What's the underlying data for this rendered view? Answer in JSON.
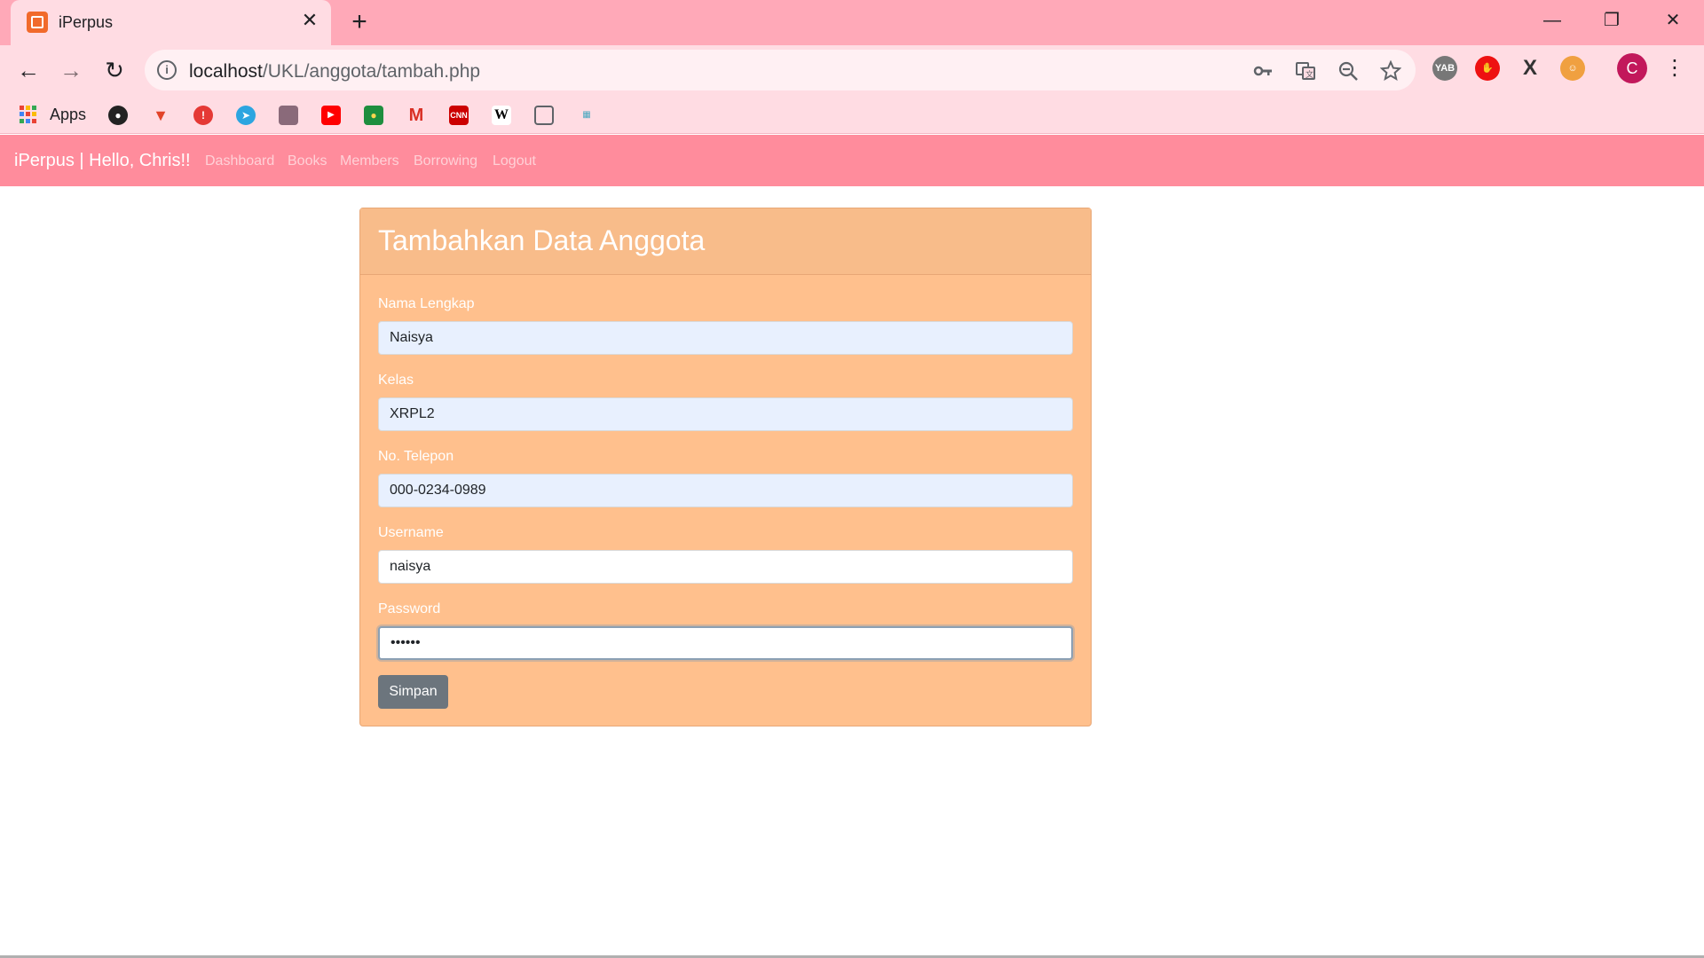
{
  "browser": {
    "tab_title": "iPerpus",
    "tab_close": "✕",
    "new_tab": "+",
    "url_host": "localhost",
    "url_path": "/UKL/anggota/tambah.php",
    "profile_initial": "C",
    "window_controls": {
      "minimize": "—",
      "restore": "❐",
      "close": "✕"
    },
    "nav": {
      "back": "←",
      "forward": "→",
      "reload": "↻"
    },
    "omnibox_icons": [
      "key-icon",
      "translate-icon",
      "zoom-out-icon",
      "star-icon"
    ],
    "extensions": [
      "YAB",
      "stop",
      "X",
      "face"
    ]
  },
  "bookmarks": {
    "apps_label": "Apps",
    "items": [
      "github-icon",
      "gitlab-icon",
      "alert-icon",
      "telegram-icon",
      "image-icon",
      "youtube-icon",
      "classroom-icon",
      "gmail-icon",
      "cnn-icon",
      "wikipedia-icon",
      "reader-icon",
      "tools-icon"
    ]
  },
  "navbar": {
    "brand": "iPerpus | Hello, Chris!!",
    "links": [
      "Dashboard",
      "Books",
      "Members",
      "Borrowing",
      "Logout"
    ]
  },
  "form": {
    "title": "Tambahkan Data Anggota",
    "fields": [
      {
        "label": "Nama Lengkap",
        "value": "Naisya"
      },
      {
        "label": "Kelas",
        "value": "XRPL2"
      },
      {
        "label": "No. Telepon",
        "value": "000-0234-0989"
      },
      {
        "label": "Username",
        "value": "naisya"
      },
      {
        "label": "Password",
        "value": "••••••"
      }
    ],
    "submit_label": "Simpan"
  },
  "colors": {
    "tab_strip": "#ffa9b8",
    "navbar": "#ff8c9c",
    "card": "#ffc08d",
    "button": "#6c757d"
  }
}
